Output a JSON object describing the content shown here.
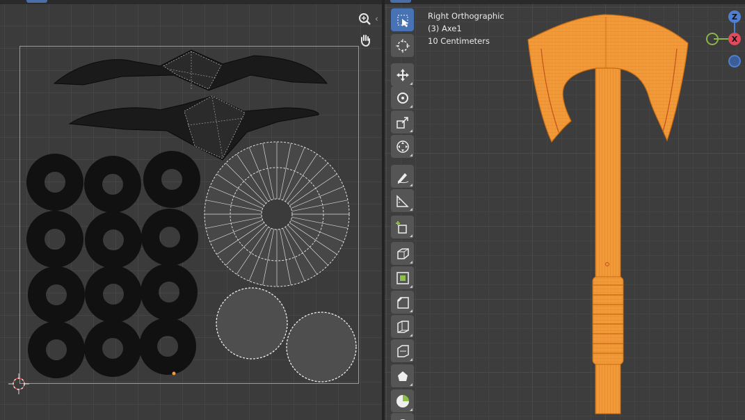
{
  "viewport": {
    "view_name": "Right Orthographic",
    "object_label": "(3) Axe1",
    "scale_label": "10 Centimeters"
  },
  "uv_editor": {
    "nav_buttons": [
      {
        "name": "zoom-icon"
      },
      {
        "name": "hand-pan-icon"
      }
    ]
  },
  "toolbar": {
    "tools": [
      {
        "name": "select-box-tool",
        "icon": "select-box-icon",
        "active": true
      },
      {
        "name": "cursor-tool",
        "icon": "cursor-icon"
      },
      {
        "name": "move-tool",
        "icon": "move-icon"
      },
      {
        "name": "rotate-tool",
        "icon": "rotate-icon"
      },
      {
        "name": "scale-tool",
        "icon": "scale-icon"
      },
      {
        "name": "transform-tool",
        "icon": "transform-icon"
      },
      {
        "name": "annotate-tool",
        "icon": "annotate-icon"
      },
      {
        "name": "measure-tool",
        "icon": "measure-icon"
      },
      {
        "name": "add-cube-tool",
        "icon": "add-cube-icon"
      },
      {
        "name": "extrude-tool",
        "icon": "extrude-icon"
      },
      {
        "name": "inset-tool",
        "icon": "inset-icon"
      },
      {
        "name": "bevel-tool",
        "icon": "bevel-icon"
      },
      {
        "name": "loop-cut-tool",
        "icon": "loop-cut-icon"
      },
      {
        "name": "knife-tool",
        "icon": "knife-icon"
      },
      {
        "name": "poly-build-tool",
        "icon": "poly-build-icon"
      },
      {
        "name": "spin-tool",
        "icon": "spin-icon"
      },
      {
        "name": "smooth-tool",
        "icon": "smooth-icon"
      }
    ]
  },
  "gizmo": {
    "z_label": "Z",
    "x_label": "X",
    "colors": {
      "z": "#4e7fd1",
      "x": "#e04a5c",
      "y": "#8ab34d"
    }
  },
  "colors": {
    "accent": "#4772b3",
    "mesh_orange": "#f29a3a",
    "mesh_wire": "#d97c1e",
    "uv_island_fill": "#505050"
  }
}
